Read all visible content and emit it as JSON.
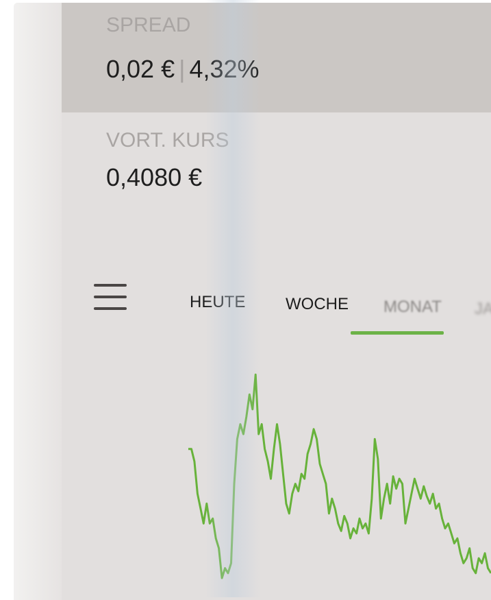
{
  "spread": {
    "label": "SPREAD",
    "absolute": "0,02 €",
    "separator": "|",
    "percent": "4,32%"
  },
  "previous_close": {
    "label": "VORT. KURS",
    "value": "0,4080 €"
  },
  "menu": {
    "icon": "hamburger-menu-icon"
  },
  "tabs": [
    {
      "label": "HEUTE",
      "active": false
    },
    {
      "label": "WOCHE",
      "active": false
    },
    {
      "label": "MONAT",
      "active": true
    },
    {
      "label": "JA",
      "active": false
    }
  ],
  "colors": {
    "accent": "#6cb247",
    "line": "#67b23a"
  },
  "chart_data": {
    "type": "line",
    "title": "",
    "xlabel": "",
    "ylabel": "",
    "grid": false,
    "x": [
      0,
      1,
      2,
      3,
      4,
      5,
      6,
      7,
      8,
      9,
      10,
      11,
      12,
      13,
      14,
      15,
      16,
      17,
      18,
      19,
      20,
      21,
      22,
      23,
      24,
      25,
      26,
      27,
      28,
      29,
      30,
      31,
      32,
      33,
      34,
      35,
      36,
      37,
      38,
      39,
      40,
      41,
      42,
      43,
      44,
      45,
      46,
      47,
      48,
      49,
      50,
      51,
      52,
      53,
      54,
      55,
      56,
      57,
      58,
      59,
      60,
      61,
      62,
      63,
      64,
      65,
      66,
      67,
      68,
      69,
      70,
      71,
      72,
      73,
      74,
      75,
      76,
      77,
      78,
      79,
      80,
      81,
      82,
      83,
      84,
      85,
      86,
      87,
      88,
      89,
      90,
      91,
      92,
      93,
      94,
      95,
      96,
      97,
      98,
      99
    ],
    "series": [
      {
        "values": [
          0.6,
          0.6,
          0.55,
          0.42,
          0.36,
          0.3,
          0.38,
          0.3,
          0.32,
          0.24,
          0.2,
          0.08,
          0.12,
          0.1,
          0.14,
          0.46,
          0.64,
          0.7,
          0.66,
          0.73,
          0.82,
          0.76,
          0.9,
          0.66,
          0.7,
          0.6,
          0.55,
          0.48,
          0.6,
          0.7,
          0.62,
          0.5,
          0.38,
          0.34,
          0.42,
          0.46,
          0.43,
          0.5,
          0.48,
          0.58,
          0.62,
          0.68,
          0.64,
          0.54,
          0.5,
          0.46,
          0.34,
          0.4,
          0.36,
          0.3,
          0.27,
          0.33,
          0.3,
          0.24,
          0.28,
          0.26,
          0.32,
          0.28,
          0.3,
          0.26,
          0.4,
          0.64,
          0.56,
          0.32,
          0.4,
          0.46,
          0.38,
          0.49,
          0.44,
          0.48,
          0.46,
          0.3,
          0.36,
          0.42,
          0.48,
          0.44,
          0.4,
          0.45,
          0.41,
          0.38,
          0.42,
          0.36,
          0.38,
          0.32,
          0.28,
          0.3,
          0.26,
          0.22,
          0.24,
          0.18,
          0.14,
          0.16,
          0.2,
          0.12,
          0.1,
          0.16,
          0.14,
          0.18,
          0.12,
          0.1
        ]
      }
    ],
    "ylim": [
      0,
      1
    ]
  }
}
